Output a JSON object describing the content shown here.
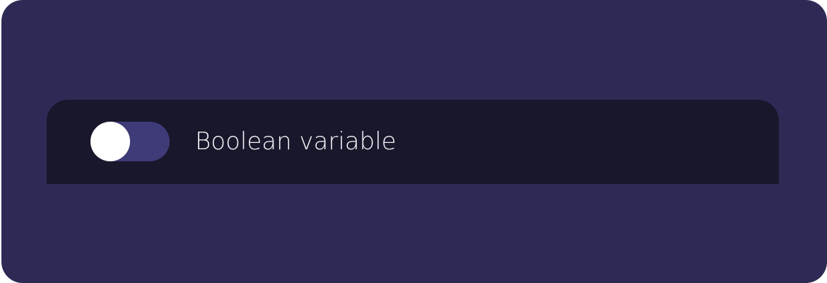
{
  "setting": {
    "label": "Boolean variable",
    "toggle_on": false
  },
  "colors": {
    "card_background": "#2d2a55",
    "row_background": "#19172b",
    "toggle_track": "#3e3b78",
    "toggle_knob": "#ffffff",
    "label_text": "#f4f4f8"
  }
}
